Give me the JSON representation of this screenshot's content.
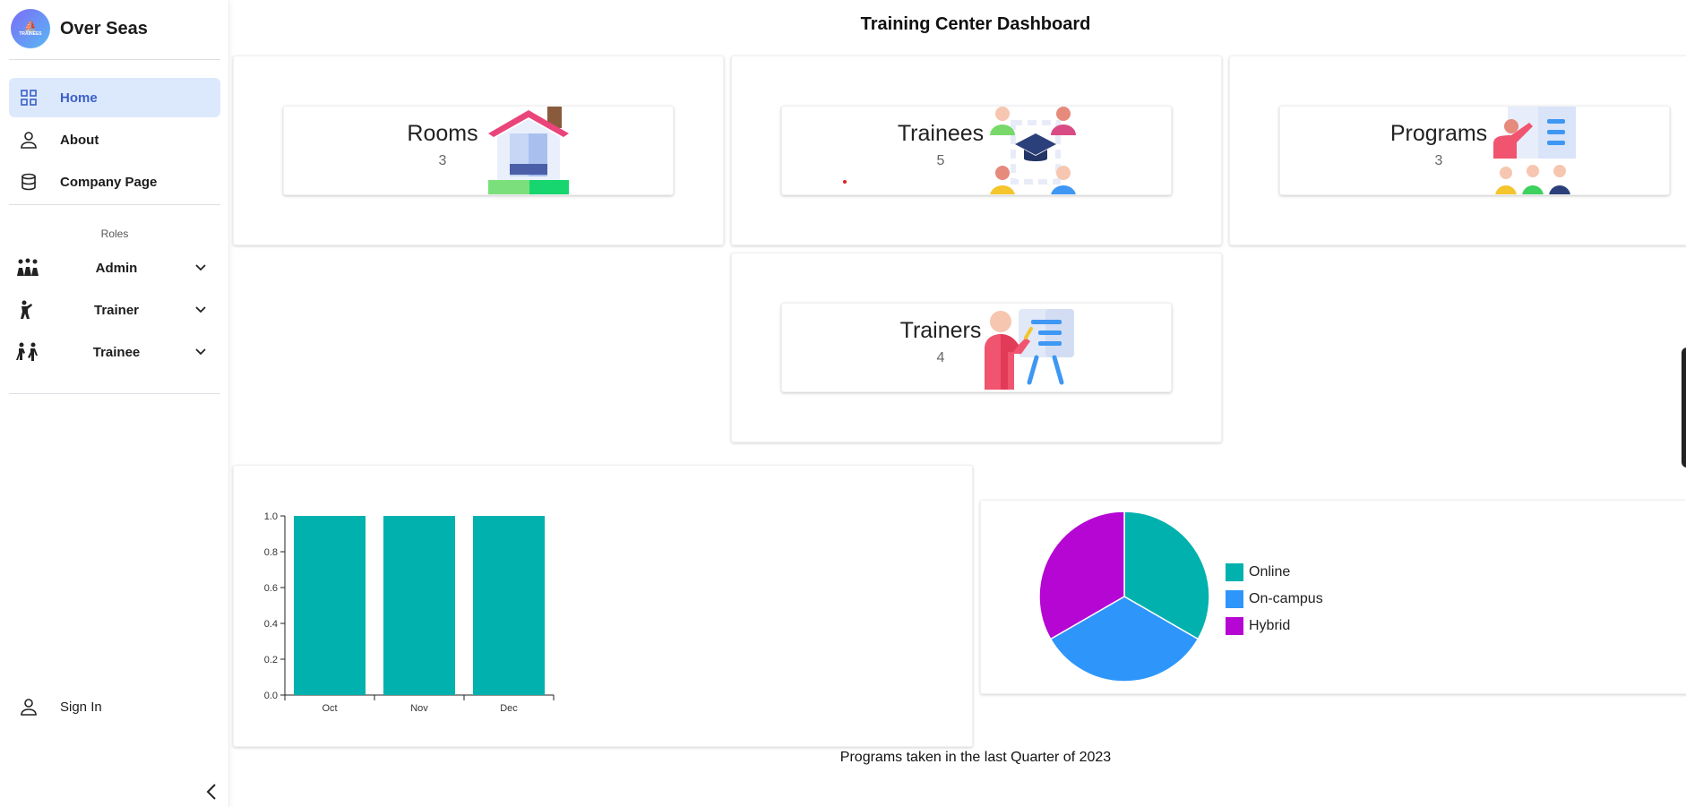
{
  "brand": {
    "name": "Over Seas",
    "logo_text": "TRAINEES"
  },
  "nav": [
    {
      "label": "Home",
      "icon": "grid-icon",
      "active": true
    },
    {
      "label": "About",
      "icon": "person-icon"
    },
    {
      "label": "Company Page",
      "icon": "database-icon"
    }
  ],
  "roles": {
    "title": "Roles",
    "items": [
      {
        "label": "Admin",
        "icon": "group-icon"
      },
      {
        "label": "Trainer",
        "icon": "trainer-icon"
      },
      {
        "label": "Trainee",
        "icon": "trainee-icon"
      }
    ]
  },
  "sign_in": {
    "label": "Sign In",
    "icon": "person-icon"
  },
  "page_title": "Training Center Dashboard",
  "cards": [
    {
      "title": "Rooms",
      "count": "3",
      "icon": "house-icon"
    },
    {
      "title": "Trainees",
      "count": "5",
      "icon": "graduation-icon"
    },
    {
      "title": "Programs",
      "count": "3",
      "icon": "presentation-icon"
    },
    {
      "title": "Trainers",
      "count": "4",
      "icon": "whiteboard-icon"
    }
  ],
  "chart_data": [
    {
      "type": "bar",
      "categories": [
        "Oct",
        "Nov",
        "Dec"
      ],
      "values": [
        1,
        1,
        1
      ],
      "ylim": [
        0,
        1
      ],
      "yticks": [
        "0.0",
        "0.2",
        "0.4",
        "0.6",
        "0.8",
        "1.0"
      ],
      "color": "#00b1ad",
      "caption": "Programs taken in the last Quarter of 2023"
    },
    {
      "type": "pie",
      "slices": [
        {
          "label": "Online",
          "value": 1,
          "color": "#00b1ad"
        },
        {
          "label": "On-campus",
          "value": 1,
          "color": "#2e96fb"
        },
        {
          "label": "Hybrid",
          "value": 1,
          "color": "#b506d3"
        }
      ]
    }
  ]
}
